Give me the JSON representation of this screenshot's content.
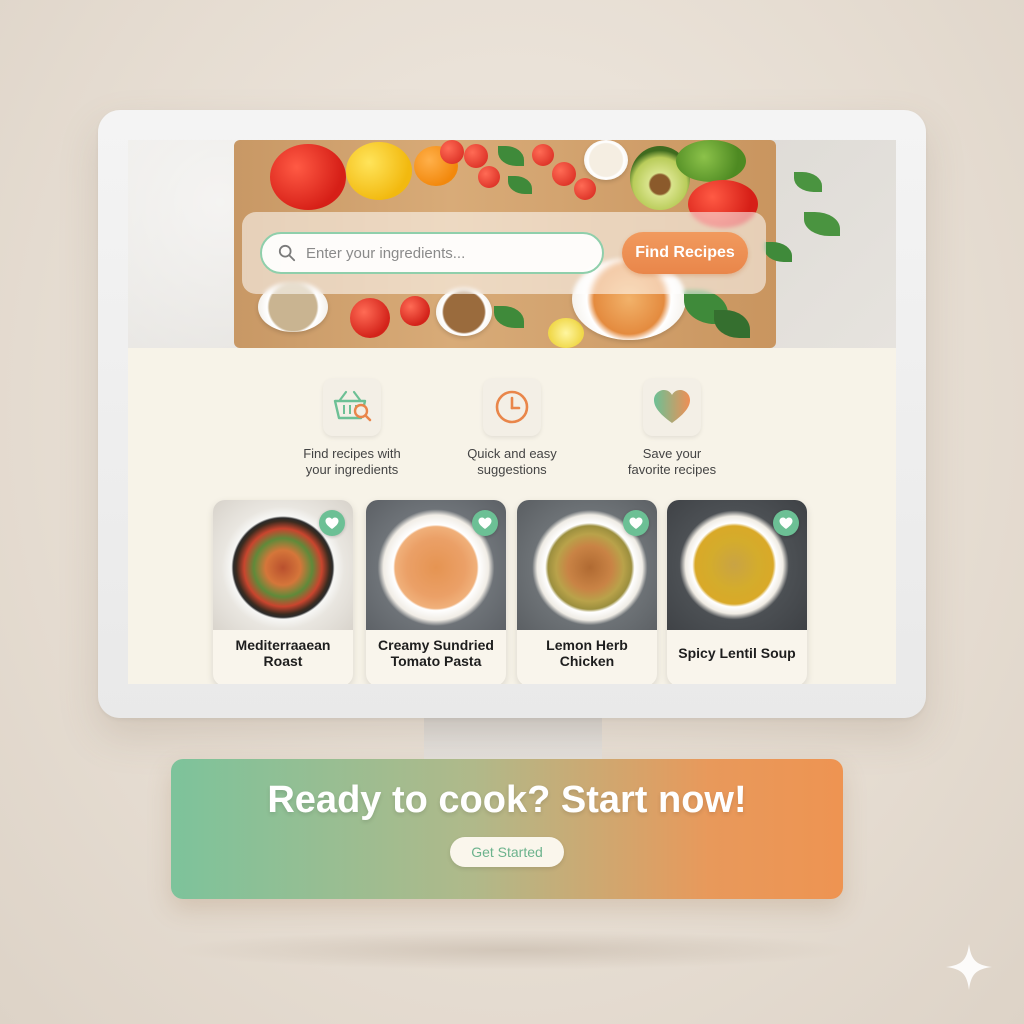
{
  "search": {
    "placeholder": "Enter your ingredients...",
    "button_label": "Find Recipes"
  },
  "features": [
    {
      "icon": "basket-search-icon",
      "line1": "Find recipes with",
      "line2": "your ingredients"
    },
    {
      "icon": "clock-icon",
      "line1": "Quick and easy",
      "line2": "suggestions"
    },
    {
      "icon": "heart-icon",
      "line1": "Save your",
      "line2": "favorite recipes"
    }
  ],
  "recipes": [
    {
      "line1": "Mediterraaean",
      "line2": "Roast",
      "favorited": true
    },
    {
      "line1": "Creamy Sundried",
      "line2": "Tomato Pasta",
      "favorited": true
    },
    {
      "line1": "Lemon Herb",
      "line2": "Chicken",
      "favorited": true
    },
    {
      "line1": "Spicy Lentil Soup",
      "line2": "",
      "favorited": true
    }
  ],
  "cta": {
    "title": "Ready to cook? Start now!",
    "button_label": "Get Started"
  },
  "colors": {
    "accent_green": "#6cc095",
    "accent_orange": "#e9864a",
    "screen_background": "#f7f3e8"
  }
}
